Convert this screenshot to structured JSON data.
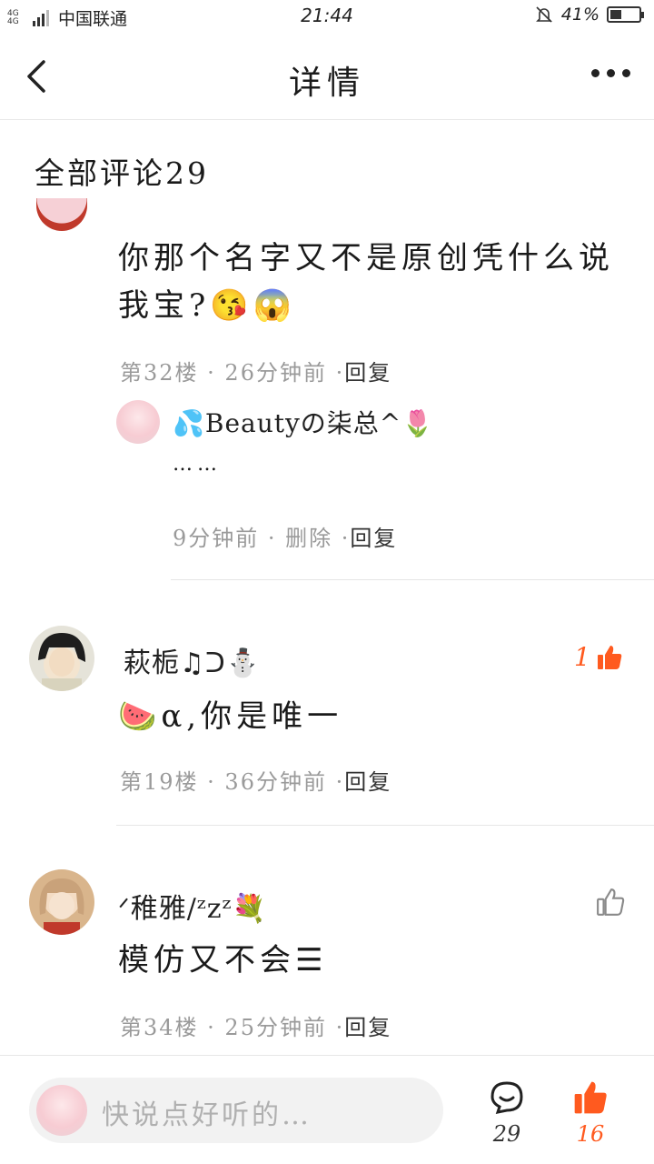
{
  "status_bar": {
    "network": "4G 4G",
    "carrier": "中国联通",
    "time": "21:44",
    "battery_percent_label": "41%",
    "battery_level": 0.41
  },
  "header": {
    "title": "详情"
  },
  "comments_section": {
    "title": "全部评论29"
  },
  "comments": [
    {
      "text": "你那个名字又不是原创凭什么说我宝?😘😱",
      "meta": "第32楼 · 26分钟前 ·",
      "reply_label": "回复",
      "sub_reply": {
        "name": "💦Beautyの柒总^🌷",
        "text": "……",
        "meta": "9分钟前 · 删除 ·",
        "reply_label": "回复"
      }
    },
    {
      "name": "萩栀♫ᑐ⛄",
      "text": "🍉α,你是唯一",
      "meta": "第19楼 · 36分钟前 ·",
      "reply_label": "回复",
      "likes": "1"
    },
    {
      "name": "ᐟ稚雅/ᶻzᶻ💐",
      "text": "模仿又不会☰",
      "meta": "第34楼 · 25分钟前 ·",
      "reply_label": "回复"
    }
  ],
  "bottom_bar": {
    "input_placeholder": "快说点好听的…",
    "comment_count": "29",
    "like_count": "16"
  },
  "colors": {
    "accent": "#ff5a1f",
    "meta_gray": "#9a9a9a"
  }
}
